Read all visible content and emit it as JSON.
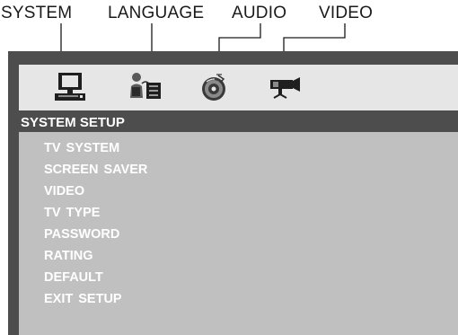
{
  "top_labels": {
    "system": "SYSTEM",
    "language": "LANGUAGE",
    "audio": "AUDIO",
    "video": "VIDEO"
  },
  "icons": {
    "system": "monitor-computer-icon",
    "language": "person-speaker-icon",
    "audio": "disc-icon",
    "video": "camera-icon"
  },
  "setup_title": "SYSTEM SETUP",
  "menu_items": [
    "TV SYSTEM",
    "SCREEN SAVER",
    "VIDEO",
    "TV TYPE",
    "PASSWORD",
    "RATING",
    "DEFAULT",
    "EXIT  SETUP"
  ],
  "colors": {
    "frame": "#4d4d4d",
    "icon_bar": "#e6e6e6",
    "menu_area": "#c0c0c0",
    "menu_text": "#ffffff"
  }
}
